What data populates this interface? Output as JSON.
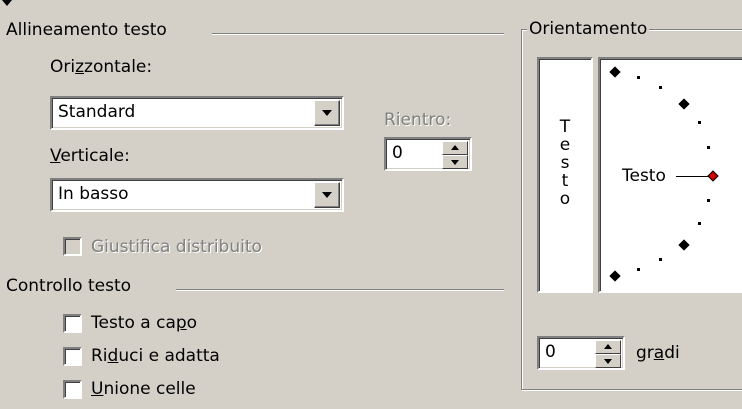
{
  "alignment": {
    "title": "Allineamento testo",
    "horizontal_label_pre": "Ori",
    "horizontal_label_key": "z",
    "horizontal_label_post": "zontale:",
    "horizontal_value": "Standard",
    "indent_label": "Rientro:",
    "indent_value": "0",
    "vertical_label_key": "V",
    "vertical_label_post": "erticale:",
    "vertical_value": "In basso",
    "justify_distributed_label": "Giustifica distribuito",
    "justify_distributed_checked": false
  },
  "text_control": {
    "title": "Controllo testo",
    "wrap_pre": "Testo a ca",
    "wrap_key": "p",
    "wrap_post": "o",
    "wrap_checked": false,
    "shrink_pre": "Ri",
    "shrink_key": "d",
    "shrink_post": "uci e adatta",
    "shrink_checked": false,
    "merge_key": "U",
    "merge_post": "nione celle",
    "merge_checked": false
  },
  "orientation": {
    "title": "Orientamento",
    "vertical_text_letters": [
      "T",
      "e",
      "s",
      "t",
      "o"
    ],
    "dial_text": "Testo",
    "degrees_value": "0",
    "degrees_pre": "gr",
    "degrees_key": "a",
    "degrees_post": "di",
    "marker_color": "#cc0000"
  },
  "icons": {
    "dropdown": "chevron-down-icon",
    "spin": "spin-updown-icon",
    "marker": "diamond-marker-icon"
  }
}
